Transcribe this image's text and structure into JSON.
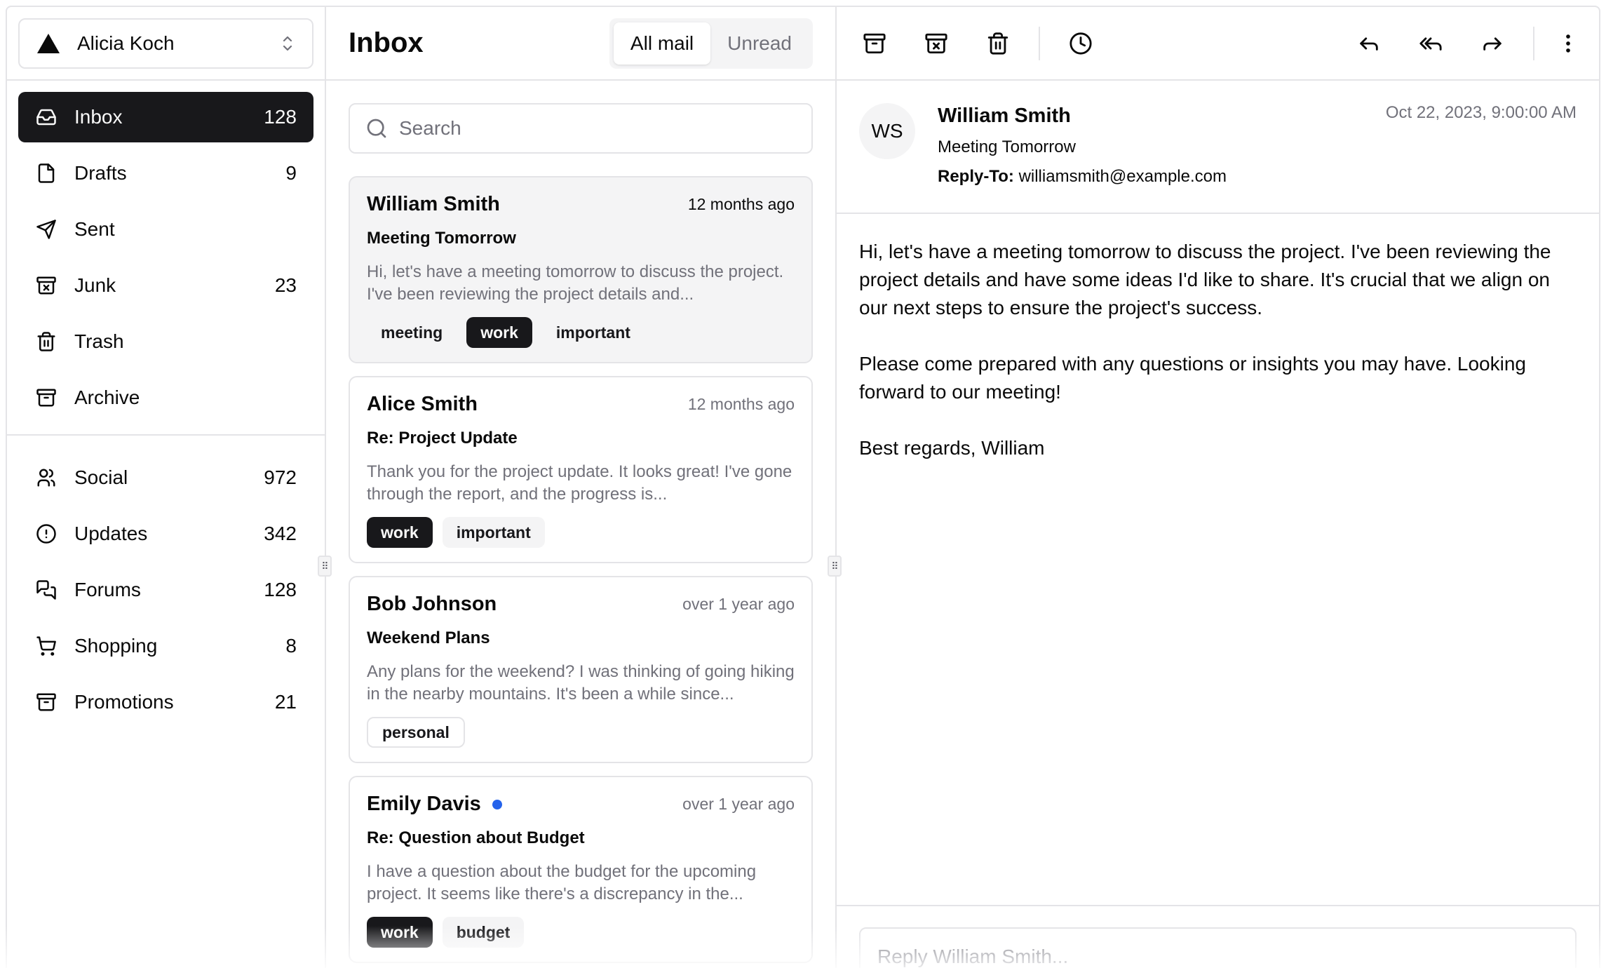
{
  "account": {
    "name": "Alicia Koch"
  },
  "nav_primary": [
    {
      "label": "Inbox",
      "count": "128",
      "icon": "inbox-icon",
      "active": true
    },
    {
      "label": "Drafts",
      "count": "9",
      "icon": "file-icon"
    },
    {
      "label": "Sent",
      "count": "",
      "icon": "send-icon"
    },
    {
      "label": "Junk",
      "count": "23",
      "icon": "archive-x-icon"
    },
    {
      "label": "Trash",
      "count": "",
      "icon": "trash-icon"
    },
    {
      "label": "Archive",
      "count": "",
      "icon": "archive-icon"
    }
  ],
  "nav_secondary": [
    {
      "label": "Social",
      "count": "972",
      "icon": "users-icon"
    },
    {
      "label": "Updates",
      "count": "342",
      "icon": "alert-circle-icon"
    },
    {
      "label": "Forums",
      "count": "128",
      "icon": "messages-icon"
    },
    {
      "label": "Shopping",
      "count": "8",
      "icon": "shopping-cart-icon"
    },
    {
      "label": "Promotions",
      "count": "21",
      "icon": "archive-icon"
    }
  ],
  "list": {
    "title": "Inbox",
    "filters": {
      "all": "All mail",
      "unread": "Unread",
      "selected": "All mail"
    },
    "search_placeholder": "Search",
    "mails": [
      {
        "name": "William Smith",
        "time": "12 months ago",
        "subject": "Meeting Tomorrow",
        "preview": "Hi, let's have a meeting tomorrow to discuss the project. I've been reviewing the project details and...",
        "tags": [
          "meeting",
          "work",
          "important"
        ],
        "unread": false,
        "selected": true
      },
      {
        "name": "Alice Smith",
        "time": "12 months ago",
        "subject": "Re: Project Update",
        "preview": "Thank you for the project update. It looks great! I've gone through the report, and the progress is...",
        "tags": [
          "work",
          "important"
        ],
        "unread": false
      },
      {
        "name": "Bob Johnson",
        "time": "over 1 year ago",
        "subject": "Weekend Plans",
        "preview": "Any plans for the weekend? I was thinking of going hiking in the nearby mountains. It's been a while since...",
        "tags": [
          "personal"
        ],
        "unread": false
      },
      {
        "name": "Emily Davis",
        "time": "over 1 year ago",
        "subject": "Re: Question about Budget",
        "preview": "I have a question about the budget for the upcoming project. It seems like there's a discrepancy in the...",
        "tags": [
          "work",
          "budget"
        ],
        "unread": true
      }
    ]
  },
  "message": {
    "initials": "WS",
    "from": "William Smith",
    "subject": "Meeting Tomorrow",
    "reply_to_label": "Reply-To:",
    "reply_to": "williamsmith@example.com",
    "date": "Oct 22, 2023, 9:00:00 AM",
    "body": [
      "Hi, let's have a meeting tomorrow to discuss the project. I've been reviewing the project details and have some ideas I'd like to share. It's crucial that we align on our next steps to ensure the project's success.",
      "Please come prepared with any questions or insights you may have. Looking forward to our meeting!",
      "Best regards, William"
    ],
    "reply_placeholder": "Reply William Smith..."
  },
  "toolbar": {
    "left": [
      "archive-icon",
      "archive-x-icon",
      "trash-icon",
      "clock-icon"
    ],
    "right": [
      "reply-icon",
      "reply-all-icon",
      "forward-icon",
      "more-vertical-icon"
    ]
  },
  "colors": {
    "active_bg": "#18181b",
    "border": "#e4e4e7",
    "muted_text": "#71717a",
    "unread_dot": "#2563eb",
    "selected_card_bg": "#f4f4f5"
  }
}
